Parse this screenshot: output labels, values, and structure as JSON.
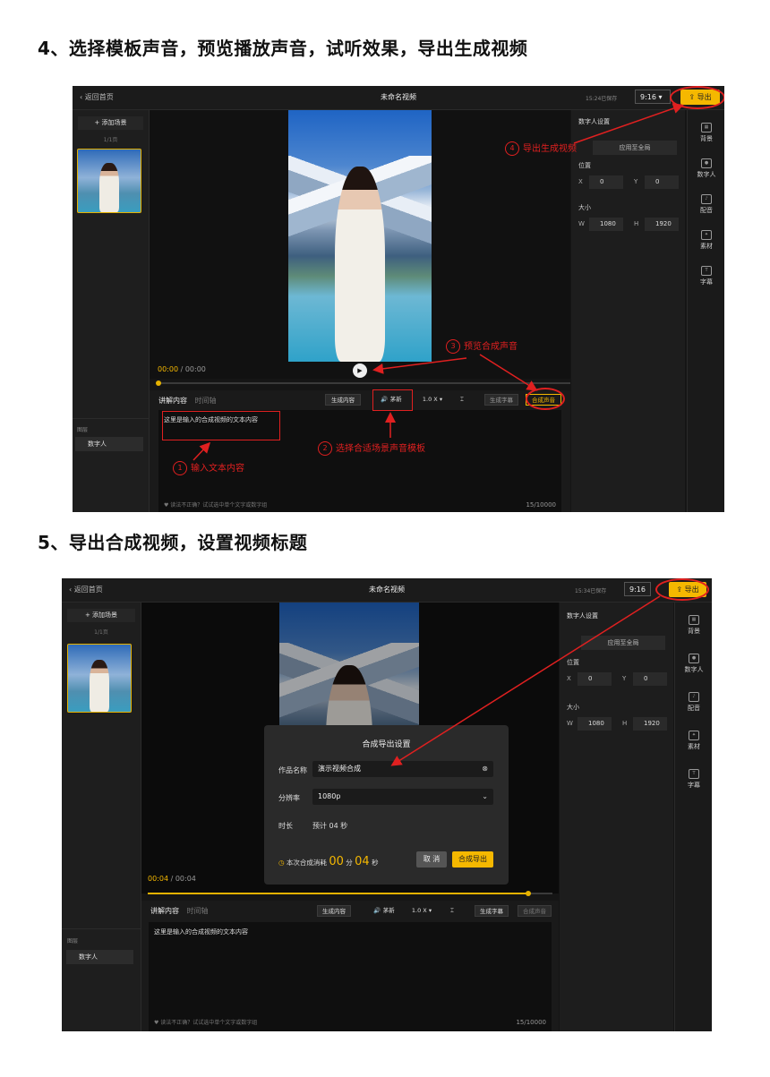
{
  "section4": {
    "title": "4、选择模板声音，预览播放声音，试听效果，导出生成视频",
    "app": {
      "back_label": "返回首页",
      "doc_title": "未命名视频",
      "saved_text": "15:24已保存",
      "ratio_value": "9:16",
      "export_label": "导出",
      "add_scene_label": "添加场景",
      "page_indicator": "1/1页",
      "layer_header": "图层",
      "layer_item": "数字人",
      "time_current": "00:00",
      "time_total": "00:00",
      "progress": 0.0,
      "tab_active": "讲解内容",
      "tab_inactive": "时间轴",
      "btn_generate_content": "生成内容",
      "btn_voice": "茅新",
      "speed_value": "1.0 X",
      "btn_subtitle": "生成字幕",
      "btn_synthesize_voice": "合成声音",
      "text_content": "这里是输入的合成视频的文本内容",
      "hint_text": "读法不正确？试试选中单个文字或数字组",
      "char_count": "15/10000",
      "panel_title": "数字人设置",
      "apply_all": "应用至全局",
      "position_label": "位置",
      "x_label": "X",
      "x_value": "0",
      "y_label": "Y",
      "y_value": "0",
      "size_label": "大小",
      "w_label": "W",
      "w_value": "1080",
      "h_label": "H",
      "h_value": "1920",
      "sidebar": [
        "背景",
        "数字人",
        "配音",
        "素材",
        "字幕"
      ]
    },
    "notes": {
      "n1_num": "1",
      "n1_text": "输入文本内容",
      "n2_num": "2",
      "n2_text": "选择合适场景声音模板",
      "n3_num": "3",
      "n3_text": "预览合成声音",
      "n4_num": "4",
      "n4_text": "导出生成视频"
    }
  },
  "section5": {
    "title": "5、导出合成视频，设置视频标题",
    "app": {
      "back_label": "返回首页",
      "doc_title": "未命名视频",
      "saved_text": "15:34已保存",
      "ratio_value": "9:16",
      "export_label": "导出",
      "add_scene_label": "添加场景",
      "page_indicator": "1/1页",
      "layer_header": "图层",
      "layer_item": "数字人",
      "time_current": "00:04",
      "time_total": "00:04",
      "progress": 0.94,
      "tab_active": "讲解内容",
      "tab_inactive": "时间轴",
      "btn_generate_content": "生成内容",
      "btn_voice": "茅新",
      "speed_value": "1.0 X",
      "btn_subtitle": "生成字幕",
      "btn_synthesize_voice": "合成声音",
      "text_content": "这里是输入的合成视频的文本内容",
      "hint_text": "读法不正确？试试选中单个文字或数字组",
      "char_count": "15/10000",
      "panel_title": "数字人设置",
      "apply_all": "应用至全局",
      "position_label": "位置",
      "x_label": "X",
      "x_value": "0",
      "y_label": "Y",
      "y_value": "0",
      "size_label": "大小",
      "w_label": "W",
      "w_value": "1080",
      "h_label": "H",
      "h_value": "1920",
      "sidebar": [
        "背景",
        "数字人",
        "配音",
        "素材",
        "字幕"
      ]
    },
    "dialog": {
      "title": "合成导出设置",
      "name_label": "作品名称",
      "name_value": "演示视频合成",
      "res_label": "分辨率",
      "res_value": "1080p",
      "duration_label": "时长",
      "duration_value": "预计 04 秒",
      "cost_label": "本次合成消耗",
      "cost_min": "00",
      "min_unit": "分",
      "cost_sec": "04",
      "sec_unit": "秒",
      "cancel": "取 消",
      "confirm": "合成导出"
    }
  },
  "colors": {
    "accent": "#f5b800",
    "annotation": "#e02020",
    "bg_dark": "#151515"
  }
}
